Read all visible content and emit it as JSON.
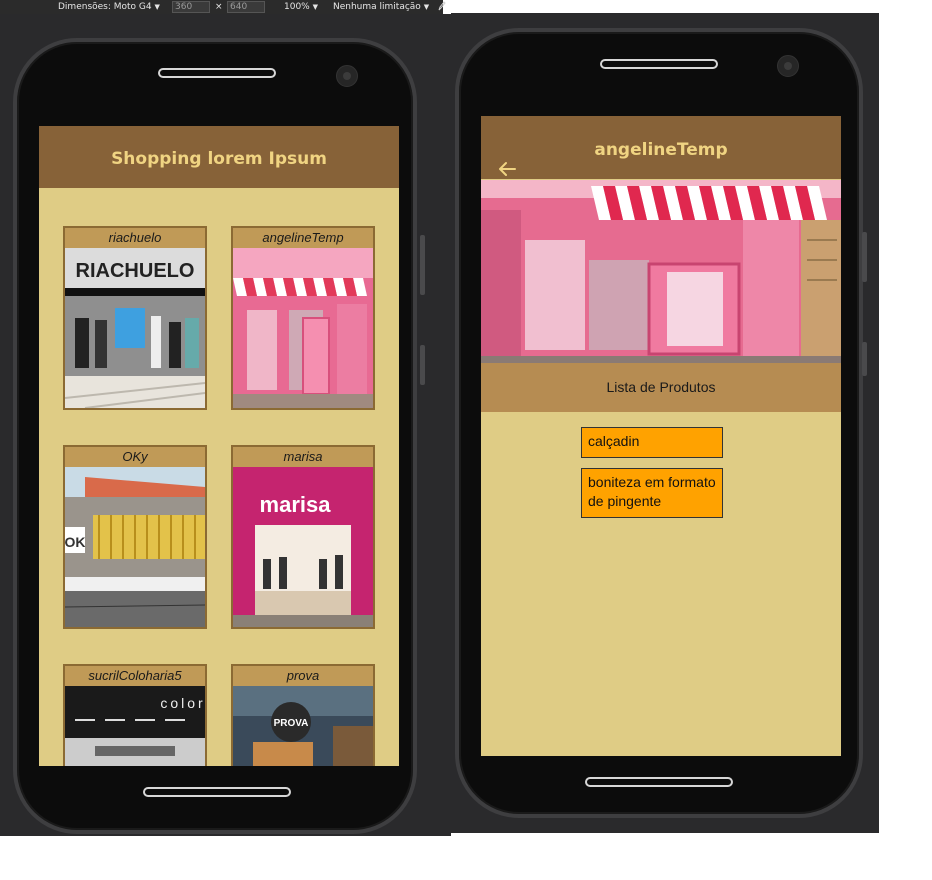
{
  "devtools": {
    "dimensions_label": "Dimensões: Moto G4",
    "width": "360",
    "times": "×",
    "height": "640",
    "zoom": "100%",
    "throttle": "Nenhuma limitação",
    "caret": "▼"
  },
  "left_screen": {
    "title": "Shopping lorem Ipsum",
    "stores": [
      {
        "name": "riachuelo",
        "sign": "RIACHUELO"
      },
      {
        "name": "angelineTemp",
        "sign": ""
      },
      {
        "name": "OKy",
        "sign": "OK"
      },
      {
        "name": "marisa",
        "sign": "marisa"
      },
      {
        "name": "sucrilColoharia5",
        "sign": "color"
      },
      {
        "name": "prova",
        "sign": "PROVA"
      }
    ]
  },
  "right_screen": {
    "title": "angelineTemp",
    "back_icon": "arrow-left-icon",
    "list_title": "Lista de Produtos",
    "products": [
      "calçadin",
      "boniteza em formato de pingente"
    ]
  },
  "colors": {
    "appbar": "#876238",
    "appbar_text": "#f0d482",
    "screen_bg": "#dfcc85",
    "list_header": "#b68c52",
    "product_bg": "#ffa200"
  }
}
